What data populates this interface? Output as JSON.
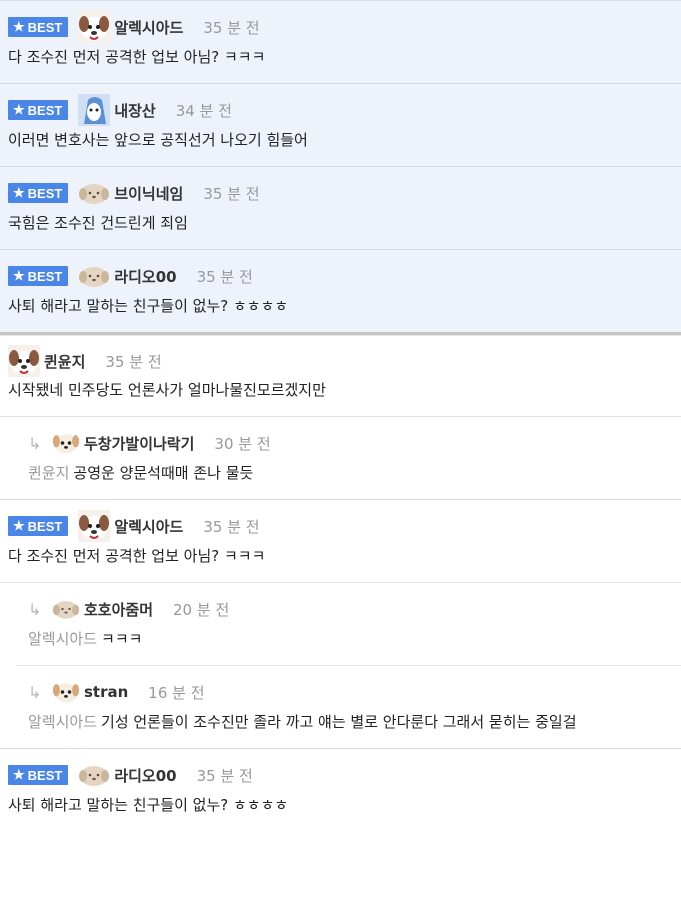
{
  "badge_label": "BEST",
  "best_comments": [
    {
      "nick": "알렉시아드",
      "time": "35 분 전",
      "text": "다 조수진 먼저 공격한 업보 아님? ㅋㅋㅋ"
    },
    {
      "nick": "내장산",
      "time": "34 분 전",
      "text": "이러면 변호사는 앞으로 공직선거 나오기 힘들어"
    },
    {
      "nick": "브이닉네임",
      "time": "35 분 전",
      "text": "국힘은 조수진 건드린게 죄임"
    },
    {
      "nick": "라디오00",
      "time": "35 분 전",
      "text": "사퇴 해라고 말하는 친구들이 없누? ㅎㅎㅎㅎ"
    }
  ],
  "thread": {
    "nick": "퀸윤지",
    "time": "35 분 전",
    "text": "시작됐네 민주당도 언론사가 얼마나물진모르겠지만",
    "reply": {
      "nick": "두창가발이나락기",
      "time": "30 분 전",
      "mention": "퀸윤지",
      "text": "공영운 양문석때매 존나 물듯"
    }
  },
  "best_thread": {
    "nick": "알렉시아드",
    "time": "35 분 전",
    "text": "다 조수진 먼저 공격한 업보 아님? ㅋㅋㅋ",
    "replies": [
      {
        "nick": "호호아줌머",
        "time": "20 분 전",
        "mention": "알렉시아드",
        "text": "ㅋㅋㅋ"
      },
      {
        "nick": "stran",
        "time": "16 분 전",
        "mention": "알렉시아드",
        "text": "기성 언론들이 조수진만 졸라 까고 얘는 별로 안다룬다 그래서 묻히는 중일걸"
      }
    ]
  },
  "best_last": {
    "nick": "라디오00",
    "time": "35 분 전",
    "text": "사퇴 해라고 말하는 친구들이 없누? ㅎㅎㅎㅎ"
  },
  "icons": {
    "badge": "star-icon",
    "reply": "reply-arrow-icon"
  },
  "colors": {
    "badge": "#4a86e8",
    "best_bg": "#eef3fb"
  }
}
